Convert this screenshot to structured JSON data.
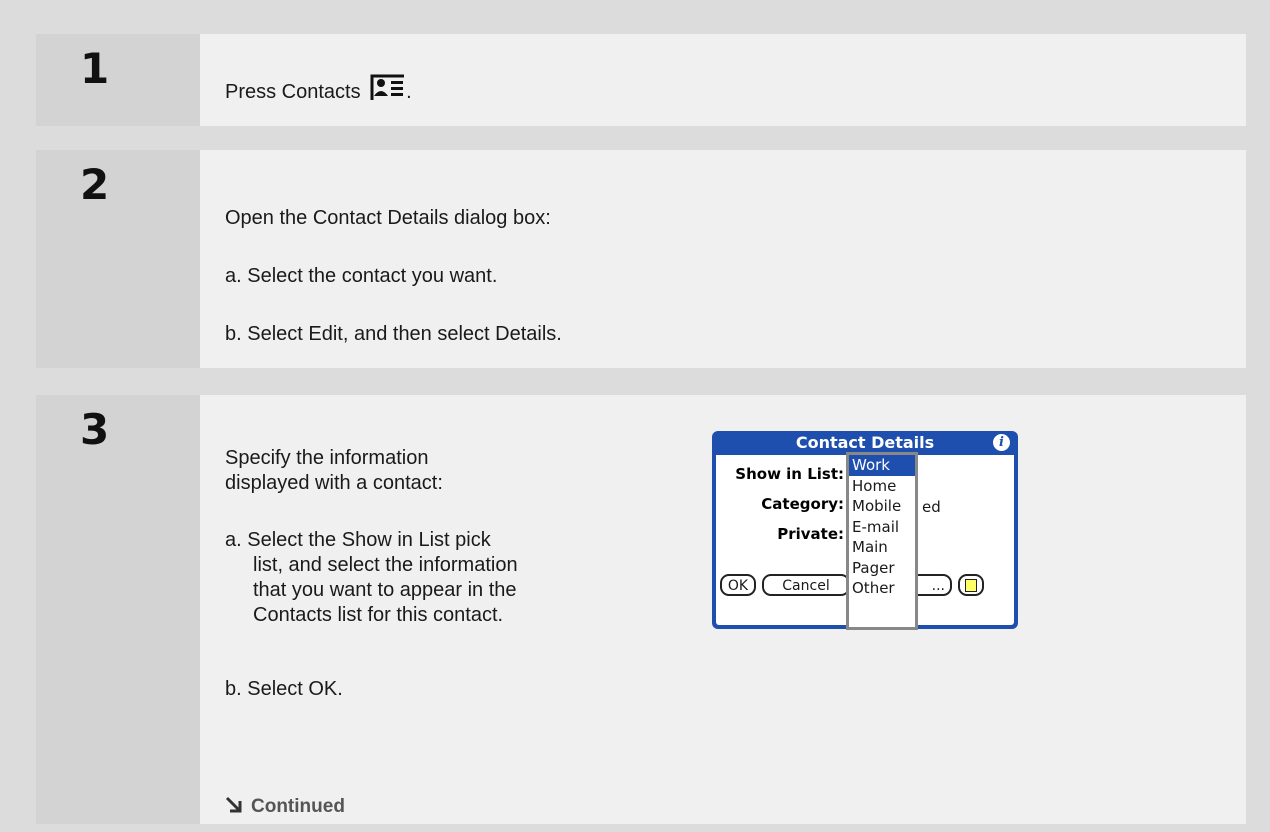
{
  "steps": [
    {
      "number": "1",
      "text_before_icon": "Press Contacts",
      "text_after_icon": "."
    },
    {
      "number": "2",
      "intro": "Open the Contact Details dialog box:",
      "items": [
        "a.  Select the contact you want.",
        "b.  Select Edit, and then select Details."
      ]
    },
    {
      "number": "3",
      "intro_lines": [
        "Specify the information",
        "displayed with a contact:"
      ],
      "item_a_lines": [
        "a.  Select the Show in List pick",
        "list, and select the information",
        "that you want to appear in the",
        "Contacts list for this contact."
      ],
      "item_b": "b.  Select OK.",
      "continued": "Continued"
    }
  ],
  "dialog": {
    "title": "Contact Details",
    "labels": {
      "show_in_list": "Show in List:",
      "category": "Category:",
      "private": "Private:"
    },
    "category_tail": "ed",
    "buttons": {
      "ok": "OK",
      "cancel": "Cancel",
      "third": "...",
      "note_icon": "note-icon"
    },
    "info_icon": "info-icon",
    "popup_options": [
      "Work",
      "Home",
      "Mobile",
      "E-mail",
      "Main",
      "Pager",
      "Other"
    ],
    "selected_option": "Work",
    "colors": {
      "accent": "#1f4fae",
      "note_yellow": "#ffff66"
    }
  }
}
